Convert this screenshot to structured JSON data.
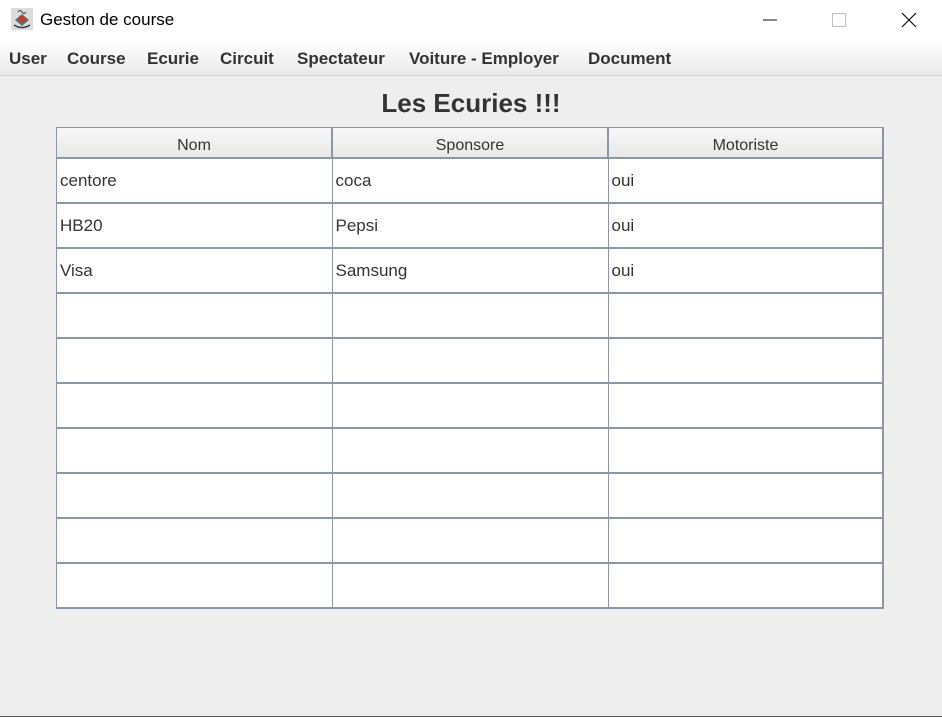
{
  "window": {
    "title": "Geston de course",
    "icon": "java-cup-icon"
  },
  "menu": {
    "items": [
      {
        "label": "User"
      },
      {
        "label": "Course"
      },
      {
        "label": "Ecurie"
      },
      {
        "label": "Circuit"
      },
      {
        "label": "Spectateur"
      },
      {
        "label": "Voiture - Employer"
      },
      {
        "label": "Document"
      }
    ]
  },
  "main": {
    "heading": "Les Ecuries !!!"
  },
  "table": {
    "columns": [
      "Nom",
      "Sponsore",
      "Motoriste"
    ],
    "rows": [
      [
        "centore",
        "coca",
        "oui"
      ],
      [
        "HB20",
        "Pepsi",
        "oui"
      ],
      [
        "Visa",
        "Samsung",
        "oui"
      ],
      [
        "",
        "",
        ""
      ],
      [
        "",
        "",
        ""
      ],
      [
        "",
        "",
        ""
      ],
      [
        "",
        "",
        ""
      ],
      [
        "",
        "",
        ""
      ],
      [
        "",
        "",
        ""
      ],
      [
        "",
        "",
        ""
      ]
    ]
  },
  "colors": {
    "background": "#eeeeee",
    "grid": "#8a97a5",
    "text": "#333333"
  }
}
